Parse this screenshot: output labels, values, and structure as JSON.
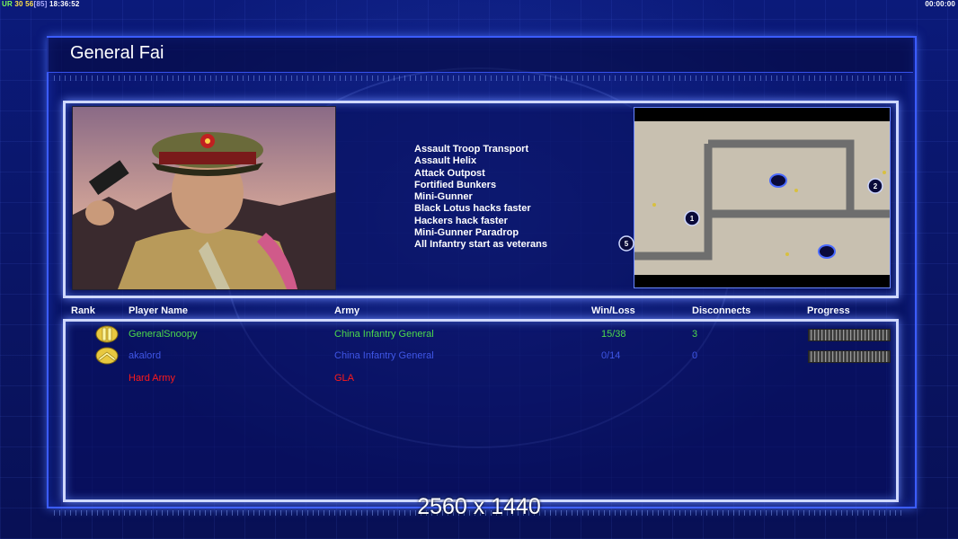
{
  "hud": {
    "ur_label": "UR",
    "value1": "30",
    "value2": "56",
    "value3": "[85]",
    "clock": "18:36:52",
    "timer": "00:00:00"
  },
  "general": {
    "name": "General Fai",
    "features": [
      "Assault Troop Transport",
      "Assault Helix",
      "Attack Outpost",
      "Fortified Bunkers",
      "Mini-Gunner",
      "Black Lotus hacks faster",
      "Hackers hack faster",
      "Mini-Gunner Paradrop",
      "All Infantry start as veterans"
    ]
  },
  "minimap": {
    "start_positions": [
      "1",
      "2",
      "5"
    ]
  },
  "table": {
    "headers": {
      "rank": "Rank",
      "player_name": "Player Name",
      "army": "Army",
      "win_loss": "Win/Loss",
      "disconnects": "Disconnects",
      "progress": "Progress"
    },
    "rows": [
      {
        "rank_icon": "double-bar-rank-icon",
        "name": "GeneralSnoopy",
        "army": "China Infantry General",
        "win_loss": "15/38",
        "disconnects": "3",
        "color": "#4cd94c",
        "progress": 0
      },
      {
        "rank_icon": "chevron-rank-icon",
        "name": "akalord",
        "army": "China Infantry General",
        "win_loss": "0/14",
        "disconnects": "0",
        "color": "#3f56e6",
        "progress": 0
      },
      {
        "rank_icon": "",
        "name": "Hard Army",
        "army": "GLA",
        "win_loss": "",
        "disconnects": "",
        "color": "#ff1a1a",
        "progress": null
      }
    ]
  },
  "footer": {
    "resolution": "2560 x 1440"
  },
  "colors": {
    "frame": "#3b5cff",
    "panel_border": "#cfd8ff",
    "background": "#0a1463"
  }
}
